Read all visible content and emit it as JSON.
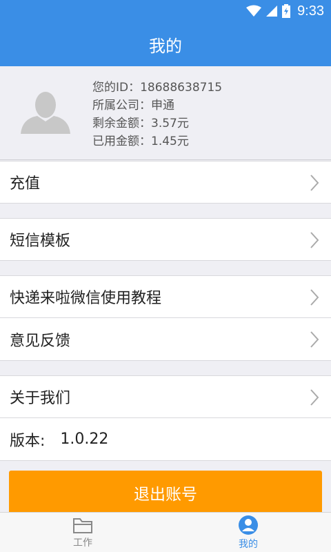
{
  "status_bar": {
    "time": "9:33"
  },
  "header": {
    "title": "我的"
  },
  "profile": {
    "id_line": "您的ID：18688638715",
    "company_line": "所属公司：申通",
    "balance_line": "剩余金额：3.57元",
    "used_line": "已用金额：1.45元"
  },
  "menu": {
    "recharge": "充值",
    "sms_template": "短信模板",
    "tutorial": "快递来啦微信使用教程",
    "feedback": "意见反馈",
    "about": "关于我们",
    "version_label": "版本:",
    "version_value": "1.0.22"
  },
  "logout": {
    "label": "退出账号"
  },
  "tabs": {
    "work": "工作",
    "mine": "我的"
  },
  "colors": {
    "primary": "#3a8ee6",
    "accent": "#ff9a00"
  }
}
